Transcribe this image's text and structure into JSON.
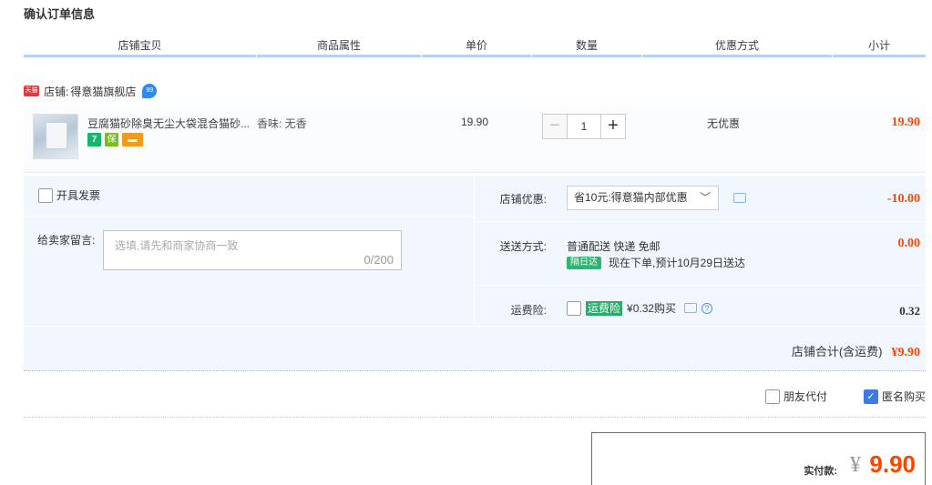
{
  "page_title": "确认订单信息",
  "columns": [
    "店铺宝贝",
    "商品属性",
    "单价",
    "数量",
    "优惠方式",
    "小计"
  ],
  "shop": {
    "badge": "天猫",
    "label": "店铺:",
    "name": "得意猫旗舰店",
    "chat_icon_text": "99"
  },
  "item": {
    "title": "豆腐猫砂除臭无尘大袋混合猫砂...",
    "attr": "香味: 无香",
    "price": "19.90",
    "quantity": "1",
    "minus": "−",
    "plus": "+",
    "discount": "无优惠",
    "subtotal": "19.90",
    "promo_7": "7",
    "promo_bao": "保"
  },
  "invoice_label": "开具发票",
  "message": {
    "label": "给卖家留言:",
    "placeholder": "选填,请先和商家协商一致",
    "count": "0/200"
  },
  "coupon": {
    "label": "店铺优惠:",
    "value": "省10元:得意猫内部优惠",
    "amount": "-10.00"
  },
  "shipping": {
    "label": "送送方式:",
    "method": "普通配送 快递 免邮",
    "badge": "隔日达",
    "eta": "现在下单,预计10月29日送达",
    "amount": "0.00"
  },
  "insurance": {
    "label": "运费险:",
    "tag": "运费险",
    "price": "¥0.32购买",
    "help": "?",
    "amount": "0.32"
  },
  "shop_total": {
    "label": "店铺合计(含运费)",
    "value": "¥9.90"
  },
  "friend_pay_label": "朋友代付",
  "anon_buy_label": "匿名购买",
  "final": {
    "label": "实付款:",
    "symbol": "¥",
    "value": "9.90"
  },
  "colors": {
    "price_red": "#ff4400",
    "header_rule": "#b2d1ff",
    "options_bg": "#f2f7ff",
    "final_border": "#e4393c"
  }
}
